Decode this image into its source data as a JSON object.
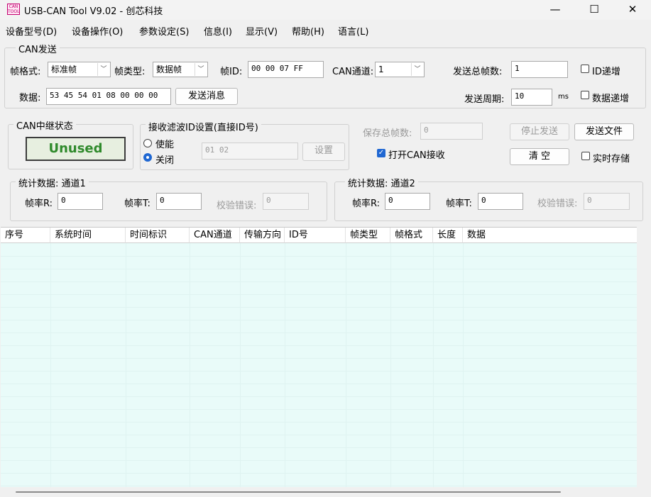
{
  "window": {
    "title": "USB-CAN Tool V9.02 - 创芯科技",
    "icon_text": "CAN TOOL",
    "minimize": "—",
    "maximize": "☐",
    "close": "✕"
  },
  "menu": [
    "设备型号(D)",
    "设备操作(O)",
    "参数设定(S)",
    "信息(I)",
    "显示(V)",
    "帮助(H)",
    "语言(L)"
  ],
  "can_send": {
    "group_title": "CAN发送",
    "frame_format_label": "帧格式:",
    "frame_format_value": "标准帧",
    "frame_type_label": "帧类型:",
    "frame_type_value": "数据帧",
    "frame_id_label": "帧ID:",
    "frame_id_value": "00 00 07 FF",
    "can_channel_label": "CAN通道:",
    "can_channel_value": "1",
    "total_frames_label": "发送总帧数:",
    "total_frames_value": "1",
    "id_increment_label": "ID递增",
    "data_label": "数据:",
    "data_value": "53 45 54 01 08 00 00 00",
    "send_button": "发送消息",
    "period_label": "发送周期:",
    "period_value": "10",
    "period_unit": "ms",
    "data_increment_label": "数据递增"
  },
  "relay": {
    "group_title": "CAN中继状态",
    "status": "Unused"
  },
  "filter": {
    "group_title": "接收滤波ID设置(直接ID号)",
    "enable_label": "使能",
    "close_label": "关闭",
    "selected": "关闭",
    "ids_value": "01 02",
    "set_button": "设置"
  },
  "right_panel": {
    "saved_total_label": "保存总帧数:",
    "saved_total_value": "0",
    "open_can_receive_label": "打开CAN接收",
    "open_can_receive_checked": true,
    "stop_send_button": "停止发送",
    "send_file_button": "发送文件",
    "clear_button": "清 空",
    "realtime_save_label": "实时存储"
  },
  "stats1": {
    "group_title": "统计数据: 通道1",
    "rate_r_label": "帧率R:",
    "rate_r_value": "0",
    "rate_t_label": "帧率T:",
    "rate_t_value": "0",
    "checksum_error_label": "校验错误:",
    "checksum_error_value": "0"
  },
  "stats2": {
    "group_title": "统计数据: 通道2",
    "rate_r_label": "帧率R:",
    "rate_r_value": "0",
    "rate_t_label": "帧率T:",
    "rate_t_value": "0",
    "checksum_error_label": "校验错误:",
    "checksum_error_value": "0"
  },
  "table": {
    "columns": [
      "序号",
      "系统时间",
      "时间标识",
      "CAN通道",
      "传输方向",
      "ID号",
      "帧类型",
      "帧格式",
      "长度",
      "数据"
    ]
  },
  "colors": {
    "status_text": "#2f8a2b",
    "table_background": "#e9fbf9",
    "accent": "#1f67d2"
  }
}
